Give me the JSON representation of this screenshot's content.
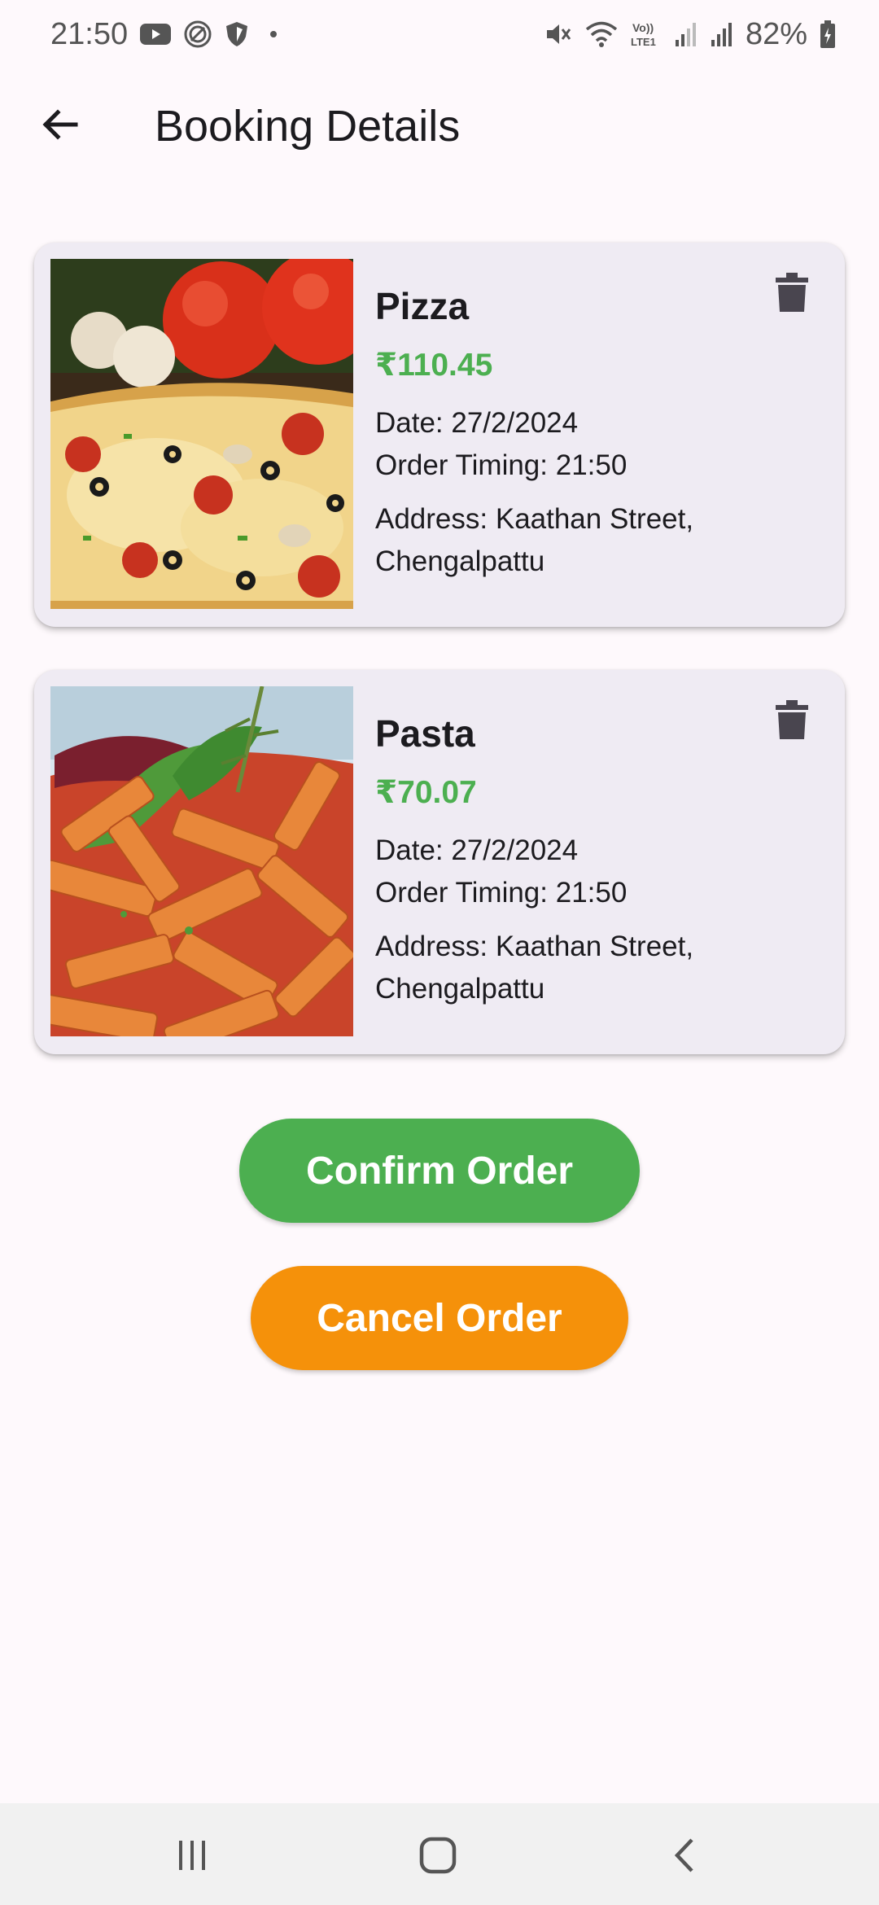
{
  "status_bar": {
    "time": "21:50",
    "battery": "82%",
    "left_icons": [
      "youtube-icon",
      "signal-tracker-icon",
      "shield-icon",
      "dot-icon"
    ],
    "right_icons": [
      "mute-icon",
      "wifi-icon",
      "volte-icon",
      "cell-signal-icon",
      "cell-signal-icon",
      "battery-icon"
    ]
  },
  "app_bar": {
    "title": "Booking Details",
    "back_icon": "arrow-back-icon"
  },
  "bookings": [
    {
      "name": "Pizza",
      "price": "₹110.45",
      "date": "Date: 27/2/2024",
      "timing": "Order Timing: 21:50",
      "address": "Address: Kaathan Street, Chengalpattu",
      "delete_icon": "trash-icon"
    },
    {
      "name": "Pasta",
      "price": "₹70.07",
      "date": "Date: 27/2/2024",
      "timing": "Order Timing: 21:50",
      "address": "Address: Kaathan Street, Chengalpattu",
      "delete_icon": "trash-icon"
    }
  ],
  "actions": {
    "confirm_label": "Confirm Order",
    "cancel_label": "Cancel Order"
  },
  "colors": {
    "price": "#4caf50",
    "confirm": "#4caf50",
    "cancel": "#f5910a",
    "card": "#efebf3",
    "background": "#fef9fc"
  },
  "nav_bar": [
    "recents-icon",
    "home-icon",
    "back-icon"
  ]
}
